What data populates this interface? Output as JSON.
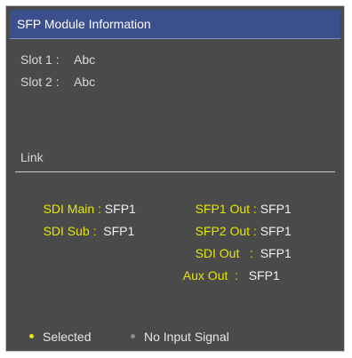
{
  "window": {
    "title": "SFP Module Information"
  },
  "slots": [
    {
      "label": "Slot 1 :",
      "value": "Abc"
    },
    {
      "label": "Slot 2 :",
      "value": "Abc"
    }
  ],
  "link": {
    "heading": "Link",
    "left": [
      {
        "label": "SDI Main :",
        "value": " SFP1"
      },
      {
        "label": "SDI Sub :",
        "value": "  SFP1"
      }
    ],
    "right": [
      {
        "label": "SFP1 Out :",
        "value": " SFP1"
      },
      {
        "label": "SFP2 Out :",
        "value": " SFP1"
      },
      {
        "label": "SDI Out   :",
        "value": "  SFP1"
      },
      {
        "label": "Aux Out  :",
        "value": "   SFP1"
      }
    ]
  },
  "legend": {
    "selected_label": "Selected",
    "selected_color": "#e6e600",
    "no_signal_label": "No Input Signal",
    "no_signal_color": "#8a8a8a"
  },
  "colors": {
    "panel_bg": "#4a4a4a",
    "title_bg": "#3b4f8d",
    "label_yellow": "#e6e600"
  }
}
